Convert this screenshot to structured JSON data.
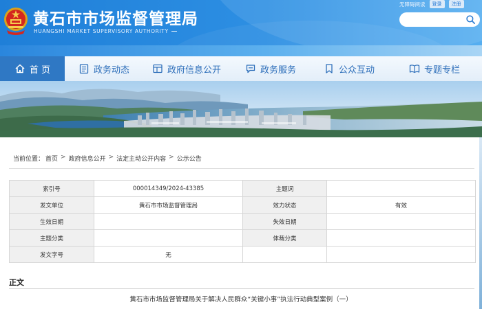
{
  "header": {
    "title": "黄石市市场监督管理局",
    "subtitle": "HUANGSHI MARKET SUPERVISORY AUTHORITY",
    "top_links": {
      "accessibility": "无障碍阅读",
      "login": "登录",
      "register": "注册"
    },
    "search": {
      "placeholder": "",
      "value": ""
    }
  },
  "nav": {
    "items": [
      {
        "label": "首 页",
        "icon": "home-icon",
        "active": true
      },
      {
        "label": "政务动态",
        "icon": "document-icon",
        "active": false
      },
      {
        "label": "政府信息公开",
        "icon": "layout-icon",
        "active": false
      },
      {
        "label": "政务服务",
        "icon": "chat-icon",
        "active": false
      },
      {
        "label": "公众互动",
        "icon": "bookmark-icon",
        "active": false
      },
      {
        "label": "专题专栏",
        "icon": "book-icon",
        "active": false
      }
    ]
  },
  "breadcrumb": {
    "prefix": "当前位置：",
    "items": [
      "首页",
      "政府信息公开",
      "法定主动公开内容",
      "公示公告"
    ],
    "separator": ">"
  },
  "info_table": {
    "rows": [
      [
        "索引号",
        "000014349/2024-43385",
        "主题词",
        ""
      ],
      [
        "发文单位",
        "黄石市市场监督管理局",
        "效力状态",
        "有效"
      ],
      [
        "生效日期",
        "",
        "失效日期",
        ""
      ],
      [
        "主题分类",
        "",
        "体裁分类",
        ""
      ],
      [
        "发文字号",
        "无",
        "",
        ""
      ]
    ]
  },
  "article": {
    "section_title": "正文",
    "title": "黄石市市场监督管理局关于解决人民群众“关键小事”执法行动典型案例（一）"
  },
  "colors": {
    "header_blue": "#1f7fd8",
    "nav_active": "#2f78c4",
    "nav_text": "#2e6fba",
    "table_label_bg": "#f0f0f0"
  }
}
